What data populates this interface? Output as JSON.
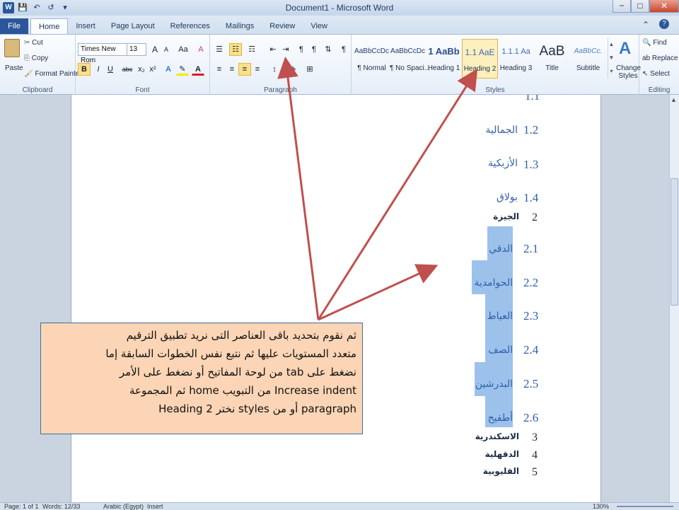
{
  "window": {
    "title": "Document1 - Microsoft Word",
    "controls": [
      "−",
      "□",
      "✕"
    ]
  },
  "quick_access": {
    "word_icon": "W",
    "save": "💾",
    "undo": "↶",
    "redo": "↺",
    "more": "▾"
  },
  "tabs": [
    "File",
    "Home",
    "Insert",
    "Page Layout",
    "References",
    "Mailings",
    "Review",
    "View"
  ],
  "ribbon": {
    "clipboard": {
      "paste": "Paste",
      "cut": "Cut",
      "copy": "Copy",
      "format_painter": "Format Painter",
      "group_label": "Clipboard"
    },
    "font": {
      "font_name": "Times New Rom",
      "font_size": "13",
      "grow": "A",
      "shrink": "A",
      "change_case": "Aa",
      "clear": "A",
      "bold": "B",
      "italic": "I",
      "underline": "U",
      "strike": "abc",
      "subscript": "x₂",
      "superscript": "x²",
      "group_label": "Font"
    },
    "paragraph": {
      "group_label": "Paragraph",
      "pilcrow": "¶"
    },
    "styles": {
      "items": [
        {
          "preview": "AaBbCcDc",
          "name": "¶ Normal"
        },
        {
          "preview": "AaBbCcDc",
          "name": "¶ No Spaci..."
        },
        {
          "preview": "1 AaBb",
          "name": "Heading 1"
        },
        {
          "preview": "1.1 AaE",
          "name": "Heading 2"
        },
        {
          "preview": "1.1.1 Aa",
          "name": "Heading 3"
        },
        {
          "preview": "AaB",
          "name": "Title"
        },
        {
          "preview": "AaBbCc.",
          "name": "Subtitle"
        }
      ],
      "change_styles": "Change Styles",
      "group_label": "Styles"
    },
    "editing": {
      "find": "Find",
      "replace": "Replace",
      "select": "Select",
      "group_label": "Editing"
    }
  },
  "document": {
    "lines": [
      {
        "num": "1.2",
        "text": "الجمالية"
      },
      {
        "num": "1.3",
        "text": "الأزبكية"
      },
      {
        "num": "1.4",
        "text": "بولاق"
      },
      {
        "num": "2",
        "text": "الجيزة"
      },
      {
        "num": "2.1",
        "text": "الدقي"
      },
      {
        "num": "2.2",
        "text": "الحوامدية"
      },
      {
        "num": "2.3",
        "text": "العياط"
      },
      {
        "num": "2.4",
        "text": "الصف"
      },
      {
        "num": "2.5",
        "text": "البدرشين"
      },
      {
        "num": "2.6",
        "text": "أطفيح"
      },
      {
        "num": "3",
        "text": "الاسكندرية"
      },
      {
        "num": "4",
        "text": "الدقهلية"
      },
      {
        "num": "5",
        "text": "القليوبية"
      }
    ]
  },
  "callout": {
    "lines": [
      "ثم نقوم بتحديد باقى العناصر التى نريد تطبيق الترقيم",
      "متعدد المستويات عليها ثم نتبع نفس الخطوات السابقة إما",
      "نضغط على tab من لوحة المفاتيح أو نضغط على الأمر",
      "Increase indent من التبويب home ثم المجموعة",
      "paragraph أو من styles نختر Heading 2"
    ]
  },
  "status": {
    "page": "Page: 1 of 1",
    "words": "Words: 12/33",
    "language": "Arabic (Egypt)",
    "mode": "Insert",
    "zoom": "130%"
  },
  "colors": {
    "arrow": "#c0504d",
    "highlight": "#9cc2ec",
    "callout_bg": "#fbd5b5"
  }
}
